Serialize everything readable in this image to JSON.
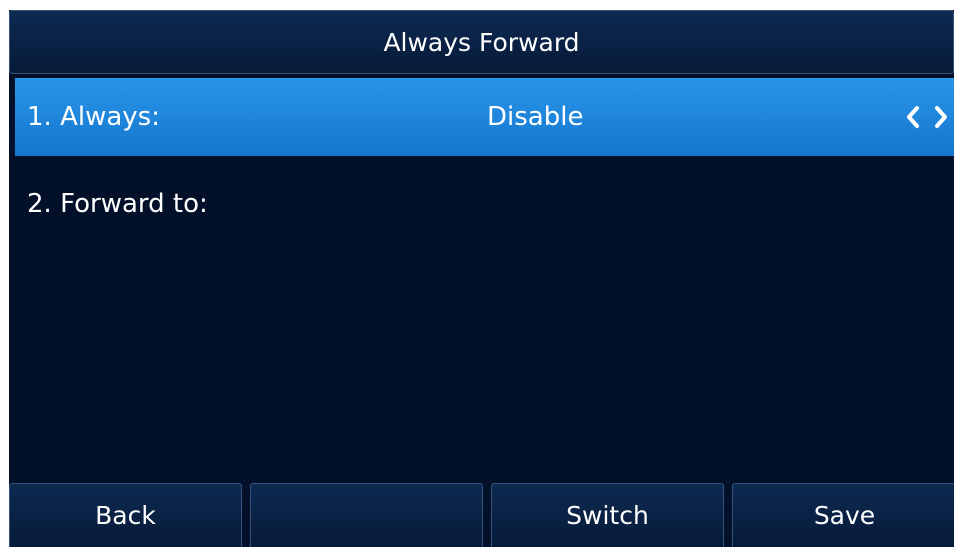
{
  "title": "Always Forward",
  "rows": [
    {
      "label": "1. Always:",
      "value": "Disable",
      "selected": true
    },
    {
      "label": "2. Forward to:",
      "value": "",
      "selected": false
    }
  ],
  "softkeys": [
    "Back",
    "",
    "Switch",
    "Save"
  ],
  "icons": {
    "prev": "chevron-left-icon",
    "next": "chevron-right-icon"
  },
  "colors": {
    "background": "#031029",
    "selected_row": "#1f86dc",
    "text": "#ffffff"
  }
}
